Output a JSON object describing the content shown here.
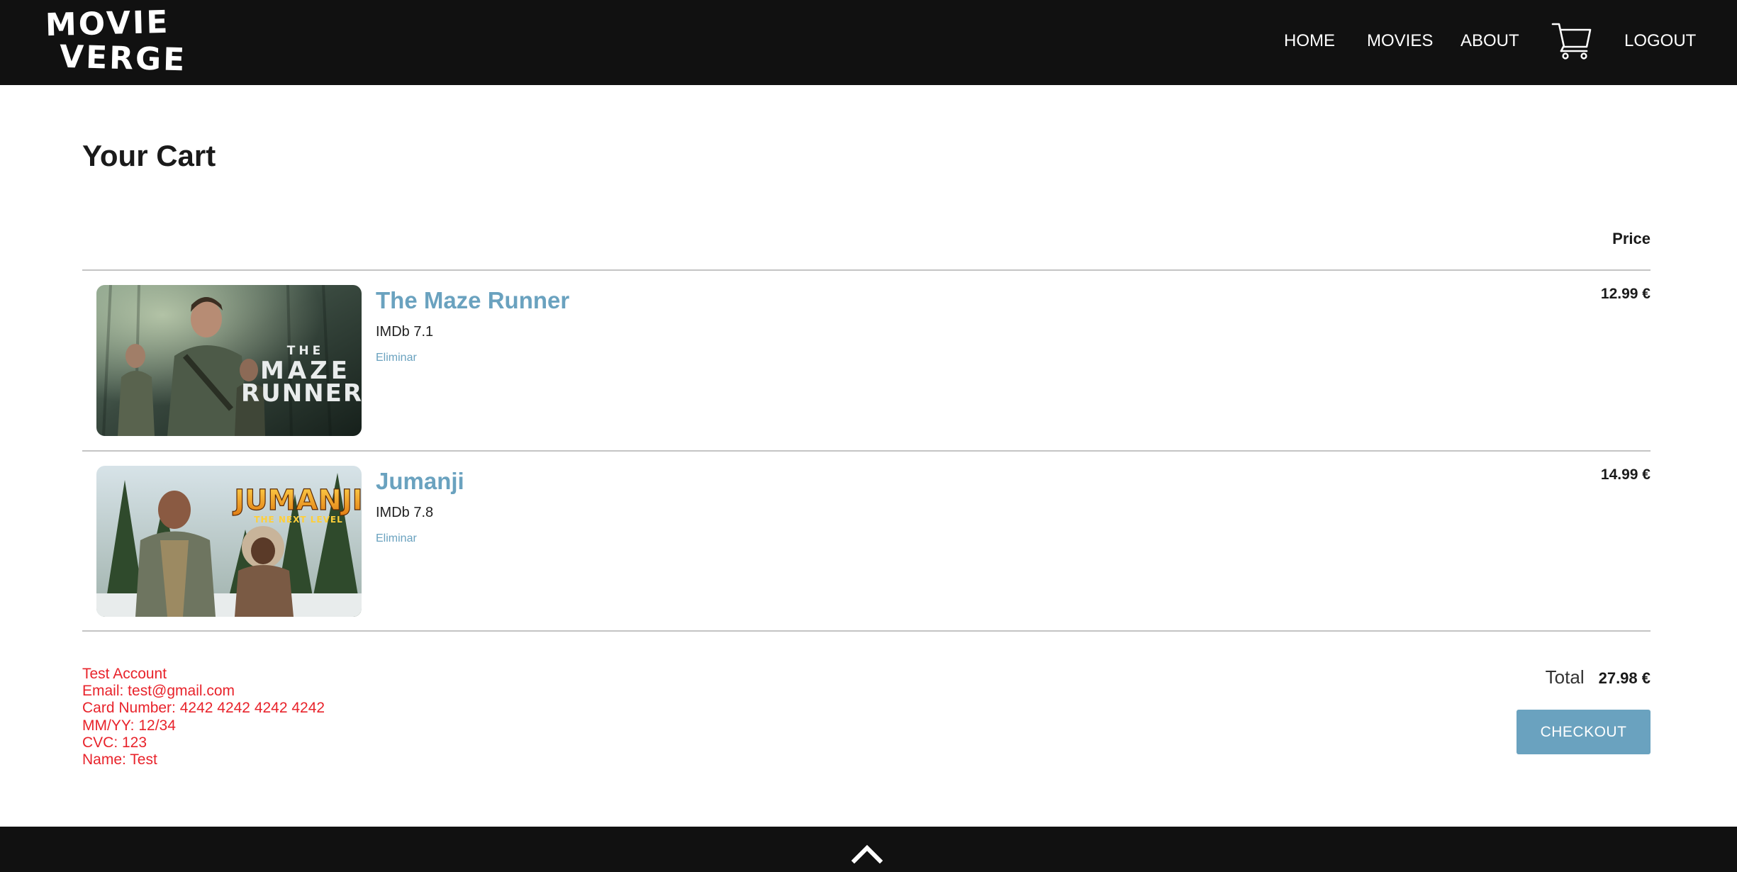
{
  "brand": {
    "line1": "MOVIE",
    "line2": "VERGE"
  },
  "nav": {
    "home": "HOME",
    "movies": "MOVIES",
    "about": "ABOUT",
    "logout": "LOGOUT",
    "cart_icon": "cart-icon"
  },
  "cart": {
    "title": "Your Cart",
    "price_header": "Price",
    "items": [
      {
        "title": "The Maze Runner",
        "rating": "IMDb 7.1",
        "remove_label": "Eliminar",
        "price": "12.99 €",
        "poster_text": [
          "THE",
          "MAZE",
          "RUNNER"
        ]
      },
      {
        "title": "Jumanji",
        "rating": "IMDb 7.8",
        "remove_label": "Eliminar",
        "price": "14.99 €",
        "poster_text": [
          "JUMANJI",
          "THE NEXT LEVEL"
        ]
      }
    ],
    "total_label": "Total",
    "total_value": "27.98 €",
    "checkout_label": "CHECKOUT"
  },
  "test_info": [
    "Test Account",
    "Email: test@gmail.com",
    "Card Number: 4242 4242 4242 4242",
    "MM/YY: 12/34",
    "CVC: 123",
    "Name: Test"
  ],
  "footer": {
    "icon": "chevron-up-icon"
  },
  "colors": {
    "navbar_bg": "#111111",
    "accent": "#6aa2bf",
    "test_info": "#e8232b",
    "divider": "#c4c4c4"
  }
}
